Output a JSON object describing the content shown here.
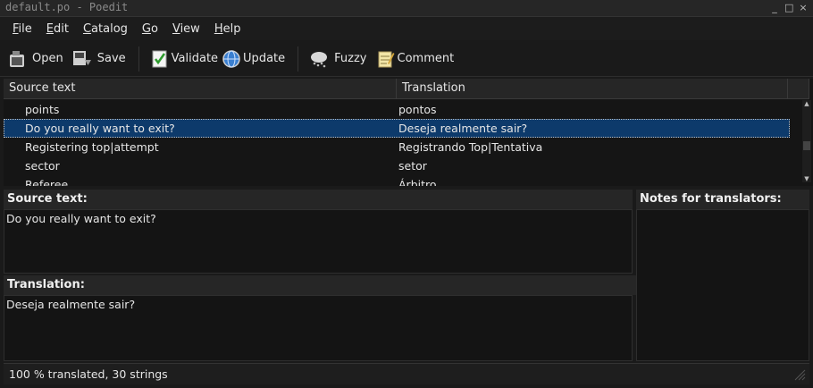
{
  "window": {
    "title": "default.po - Poedit",
    "controls": [
      "_",
      "□",
      "×"
    ]
  },
  "menu": [
    {
      "prefix": "",
      "u": "F",
      "rest": "ile"
    },
    {
      "prefix": "",
      "u": "E",
      "rest": "dit"
    },
    {
      "prefix": "",
      "u": "C",
      "rest": "atalog"
    },
    {
      "prefix": "",
      "u": "G",
      "rest": "o"
    },
    {
      "prefix": "",
      "u": "V",
      "rest": "iew"
    },
    {
      "prefix": "",
      "u": "H",
      "rest": "elp"
    }
  ],
  "toolbar": {
    "open": "Open",
    "save": "Save",
    "validate": "Validate",
    "update": "Update",
    "fuzzy": "Fuzzy",
    "comment": "Comment"
  },
  "list": {
    "headers": {
      "source": "Source text",
      "translation": "Translation"
    },
    "rows": [
      {
        "source": "points",
        "translation": "pontos",
        "selected": false
      },
      {
        "source": "Do you really want to exit?",
        "translation": "Deseja realmente sair?",
        "selected": true
      },
      {
        "source": "Registering top|attempt",
        "translation": "Registrando Top|Tentativa",
        "selected": false
      },
      {
        "source": "sector",
        "translation": "setor",
        "selected": false
      },
      {
        "source": "Referee",
        "translation": "Árbitro",
        "selected": false
      }
    ]
  },
  "editor": {
    "source_label": "Source text:",
    "source_value": "Do you really want to exit?",
    "translation_label": "Translation:",
    "translation_value": "Deseja realmente sair?",
    "notes_label": "Notes for translators:",
    "notes_value": ""
  },
  "status": {
    "text": "100 % translated, 30 strings"
  },
  "colors": {
    "selection": "#0d3a6b",
    "background": "#1a1a1a",
    "panel": "#262626"
  }
}
